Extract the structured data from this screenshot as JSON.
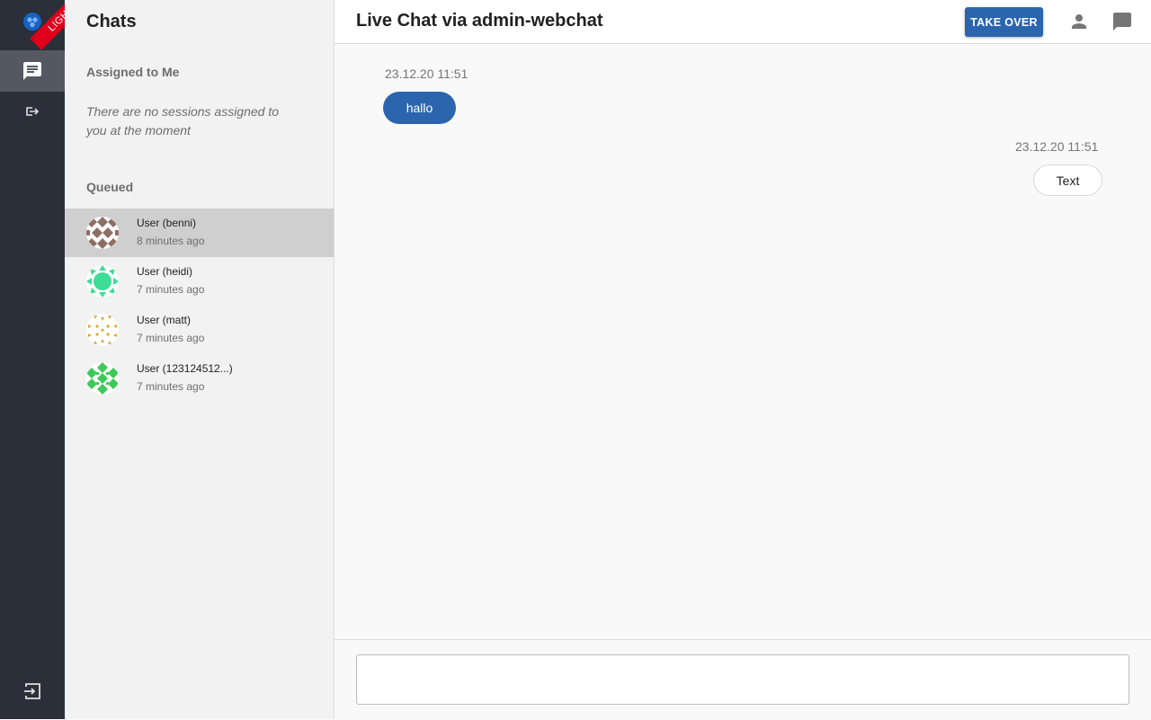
{
  "rail": {
    "badge": "LIGHT",
    "items": [
      {
        "name": "chats",
        "icon": "chat-icon",
        "active": true
      },
      {
        "name": "handover",
        "icon": "forward-icon",
        "active": false
      }
    ],
    "logout_icon": "logout-icon"
  },
  "chat_list": {
    "title": "Chats",
    "assigned_heading": "Assigned to Me",
    "assigned_empty": "There are no sessions assigned to you at the moment",
    "queued_heading": "Queued",
    "queued": [
      {
        "name": "User (benni)",
        "time": "8 minutes ago",
        "selected": true,
        "color": "#8d6e63"
      },
      {
        "name": "User (heidi)",
        "time": "7 minutes ago",
        "selected": false,
        "color": "#3ddc97"
      },
      {
        "name": "User (matt)",
        "time": "7 minutes ago",
        "selected": false,
        "color": "#e2a53a"
      },
      {
        "name": "User (123124512...)",
        "time": "7 minutes ago",
        "selected": false,
        "color": "#3ec95a"
      }
    ]
  },
  "conversation": {
    "title": "Live Chat via admin-webchat",
    "take_over_label": "TAKE OVER",
    "messages": [
      {
        "side": "left",
        "time": "23.12.20 11:51",
        "text": "hallo"
      },
      {
        "side": "right",
        "time": "23.12.20 11:51",
        "text": "Text"
      }
    ],
    "composer": {
      "value": "",
      "placeholder": ""
    }
  },
  "colors": {
    "accent": "#2b65ad",
    "rail": "#2b2f3a",
    "badge": "#e0001b"
  }
}
